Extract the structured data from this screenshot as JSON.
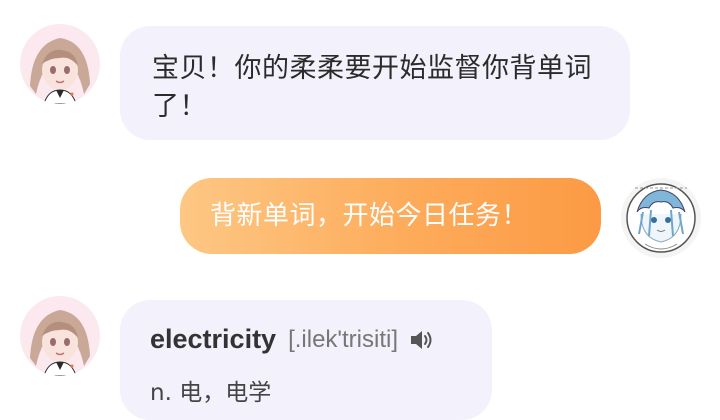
{
  "chat": {
    "messages": [
      {
        "sender": "bot",
        "text": "宝贝！你的柔柔要开始监督你背单词了！"
      },
      {
        "sender": "user",
        "text": "背新单词，开始今日任务！"
      },
      {
        "sender": "bot",
        "word": "electricity",
        "phonetic": "[.ilek'trisiti]",
        "definition": "n. 电，电学"
      }
    ]
  },
  "colors": {
    "incoming_bubble": "#f3f1fb",
    "outgoing_bubble_start": "#fdc784",
    "outgoing_bubble_end": "#fc9a45",
    "word_text": "#333333",
    "phonetic_text": "#777777"
  },
  "icons": {
    "bot_avatar": "anime-character-avatar",
    "user_avatar": "sketch-character-avatar",
    "pronunciation": "speaker-icon"
  }
}
